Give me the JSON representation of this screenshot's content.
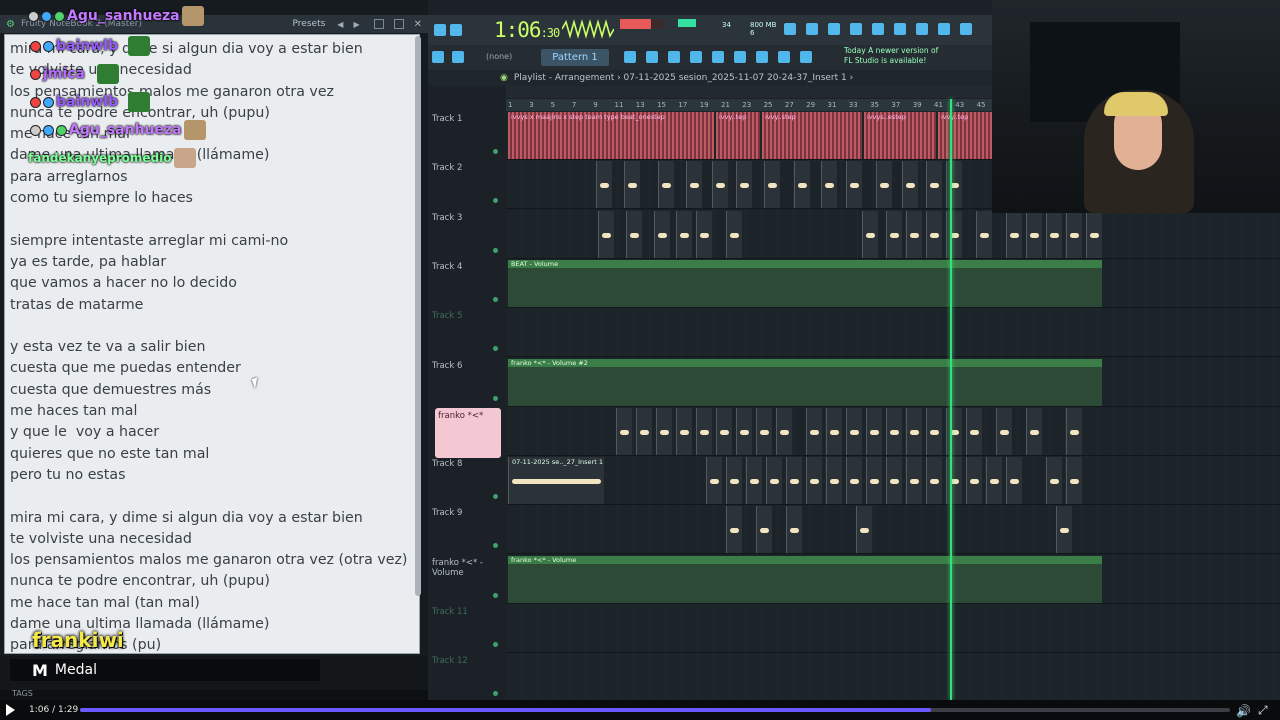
{
  "notebook": {
    "title": "Fruity NoteBook 2 (Master)",
    "presets_label": "Presets",
    "lines": [
      "mira mi cara, y dime si algun dia voy a estar bien",
      "te volviste una necesidad",
      "los pensamientos malos me ganaron otra vez",
      "nunca te podre encontrar, uh (pupu)",
      "me hace tan mal",
      "dame una ultima llamada (llámame)",
      "para arreglarnos",
      "como tu siempre lo haces",
      "",
      "siempre intentaste arreglar mi cami-no",
      "ya es tarde, pa hablar",
      "que vamos a hacer no lo decido",
      "tratas de matarme",
      "",
      "y esta vez te va a salir bien",
      "cuesta que me puedas entender",
      "cuesta que demuestres más",
      "me haces tan mal",
      "y que le  voy a hacer",
      "quieres que no este tan mal",
      "pero tu no estas",
      "",
      "mira mi cara, y dime si algun dia voy a estar bien",
      "te volviste una necesidad",
      "los pensamientos malos me ganaron otra vez (otra vez)",
      "nunca te podre encontrar, uh (pupu)",
      "me hace tan mal (tan mal)",
      "dame una ultima llamada (llámame)",
      "para arreglarnos (pu)"
    ]
  },
  "chat": [
    {
      "name": "Agu_sanhueza",
      "color": "#c478ff"
    },
    {
      "name": "bainwlb",
      "color": "#9b5cff"
    },
    {
      "name": "jmica",
      "color": "#b46bff"
    },
    {
      "name": "bainwlb",
      "color": "#9b5cff"
    },
    {
      "name": "Agu_sanhueza",
      "color": "#c478ff"
    },
    {
      "name": "fandekanyepromedio",
      "color": "#7dff9a"
    }
  ],
  "overlay": {
    "streamer": "frankiwi",
    "medal_label": "Medal",
    "tags_label": "TAGS"
  },
  "fl": {
    "time": "1:06",
    "time_small": ":30",
    "cpu_text": "34",
    "mem_text": "800 MB",
    "mem_text2": "6",
    "pattern_label": "Pattern 1",
    "none_label": "(none)",
    "news_line1": "Today  A newer version of",
    "news_line2": "FL Studio is available!",
    "playlist_title": "Playlist - Arrangement › 07-11-2025 sesion_2025-11-07 20-24-37_Insert 1 ›",
    "ruler": [
      "1",
      "3",
      "5",
      "7",
      "9",
      "11",
      "13",
      "15",
      "17",
      "19",
      "21",
      "23",
      "25",
      "27",
      "29",
      "31",
      "33",
      "35",
      "37",
      "39",
      "41",
      "43",
      "45"
    ]
  },
  "tracks": [
    {
      "name": "Track 1",
      "muted": false
    },
    {
      "name": "Track 2",
      "muted": false
    },
    {
      "name": "Track 3",
      "muted": false
    },
    {
      "name": "Track 4",
      "muted": false
    },
    {
      "name": "Track 5",
      "muted": true
    },
    {
      "name": "Track 6",
      "muted": false
    },
    {
      "name": "franko *<*",
      "muted": false
    },
    {
      "name": "Track 8",
      "muted": false
    },
    {
      "name": "Track 9",
      "muted": false
    },
    {
      "name": "franko *<* - Volume",
      "muted": false
    },
    {
      "name": "Track 11",
      "muted": true
    },
    {
      "name": "Track 12",
      "muted": true
    }
  ],
  "clip_labels": {
    "t1": [
      "ivvys x maajins x step team type beat_onestep",
      "ivvy..tep",
      "ivvy..step",
      "ivvys..estep",
      "ivvy..tep",
      "iv..ep",
      "ivv"
    ],
    "t4": "BEAT - Volume",
    "t6": "franko *<* - Volume #2",
    "t8": "07-11-2025 se.._27_Insert 1",
    "t10": "franko *<* - Volume"
  },
  "player": {
    "timecode": "1:06 / 1:29",
    "progress": 0.74
  },
  "colors": {
    "accent_green": "#35e07a",
    "seek_fill": "#6a5bff",
    "streamer_name": "#f2e84a"
  }
}
